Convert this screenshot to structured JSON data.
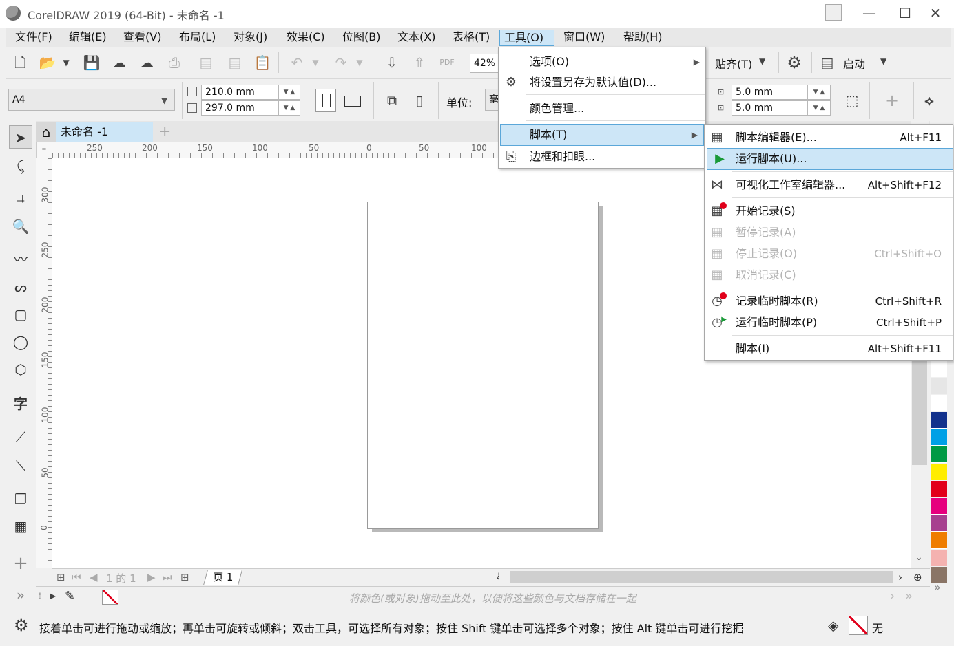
{
  "window": {
    "title": "CorelDRAW 2019 (64-Bit) - 未命名 -1",
    "minimize": "—",
    "maximize": "☐",
    "close": "✕"
  },
  "menubar": [
    "文件(F)",
    "编辑(E)",
    "查看(V)",
    "布局(L)",
    "对象(J)",
    "效果(C)",
    "位图(B)",
    "文本(X)",
    "表格(T)",
    "工具(O)",
    "窗口(W)",
    "帮助(H)"
  ],
  "toolbar": {
    "zoom": "42%",
    "snap_label": "贴齐(T)",
    "launch_label": "启动",
    "pdf_label": "PDF"
  },
  "property_bar": {
    "page_size": "A4",
    "width": "210.0 mm",
    "height": "297.0 mm",
    "units_label": "单位:",
    "units_value": "毫",
    "nudge_x": "5.0 mm",
    "nudge_y": "5.0 mm"
  },
  "document": {
    "tab_label": "未命名 -1",
    "page_tab": "页 1",
    "page_of": "1 的 1"
  },
  "rulers": {
    "h": [
      "250",
      "200",
      "150",
      "100",
      "50",
      "0",
      "50",
      "100"
    ],
    "v": [
      "300",
      "250",
      "200",
      "150",
      "100",
      "50",
      "0"
    ]
  },
  "tools_menu": {
    "items": [
      "选项(O)",
      "将设置另存为默认值(D)...",
      "颜色管理...",
      "脚本(T)",
      "边框和扣眼..."
    ]
  },
  "script_submenu": {
    "items": [
      {
        "label": "脚本编辑器(E)...",
        "shortcut": "Alt+F11",
        "state": "enabled"
      },
      {
        "label": "运行脚本(U)...",
        "shortcut": "",
        "state": "highlighted"
      },
      {
        "label": "可视化工作室编辑器...",
        "shortcut": "Alt+Shift+F12",
        "state": "enabled"
      },
      {
        "label": "开始记录(S)",
        "shortcut": "",
        "state": "enabled"
      },
      {
        "label": "暂停记录(A)",
        "shortcut": "",
        "state": "disabled"
      },
      {
        "label": "停止记录(O)",
        "shortcut": "Ctrl+Shift+O",
        "state": "disabled"
      },
      {
        "label": "取消记录(C)",
        "shortcut": "",
        "state": "disabled"
      },
      {
        "label": "记录临时脚本(R)",
        "shortcut": "Ctrl+Shift+R",
        "state": "enabled"
      },
      {
        "label": "运行临时脚本(P)",
        "shortcut": "Ctrl+Shift+P",
        "state": "enabled"
      },
      {
        "label": "脚本(I)",
        "shortcut": "Alt+Shift+F11",
        "state": "enabled"
      }
    ]
  },
  "colorbar": {
    "hint": "将颜色(或对象)拖动至此处，以便将这些颜色与文档存储在一起"
  },
  "status": {
    "message": "接着单击可进行拖动或缩放；再单击可旋转或倾斜；双击工具，可选择所有对象；按住 Shift 键单击可选择多个对象；按住 Alt 键单击可进行挖掘",
    "fill_label": "无"
  },
  "palette": [
    "#ffffff",
    "#e6e6e6",
    "#ffffff",
    "#12318c",
    "#00a0e6",
    "#009a44",
    "#ffed00",
    "#e2001a",
    "#e6007e",
    "#a7408f",
    "#ef7d00",
    "#f4b2b0",
    "#8a7566"
  ],
  "colors": {
    "accent": "#5ba7d9",
    "highlight": "#cde6f7",
    "run_icon": "#1a9a38",
    "record_dot": "#e0001b"
  }
}
